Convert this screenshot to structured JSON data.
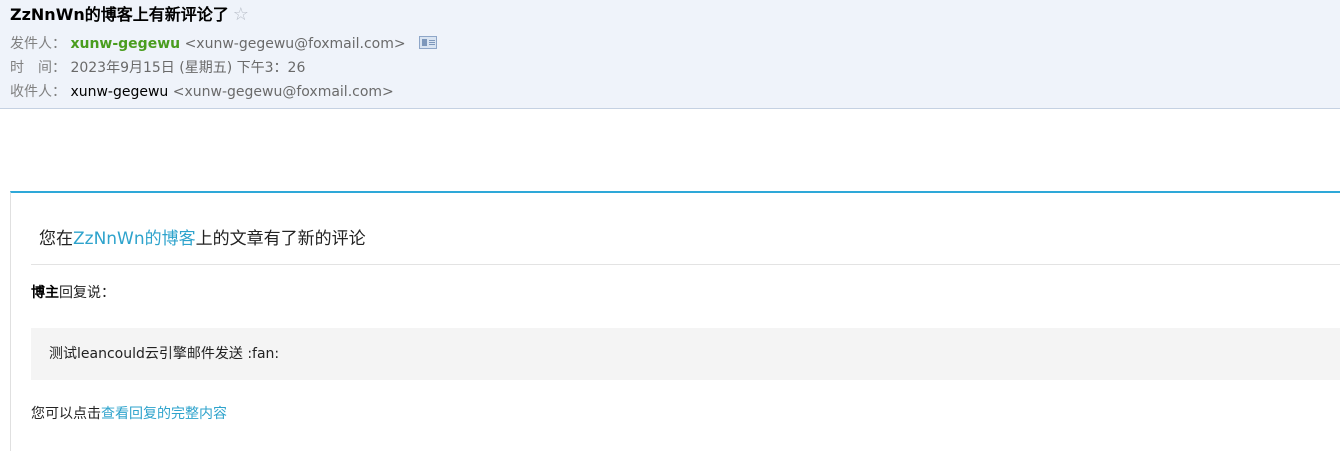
{
  "subject": "ZzNnWn的博客上有新评论了",
  "star_icon": "☆",
  "from": {
    "label": "发件人：",
    "name": "xunw-gegewu",
    "address": "<xunw-gegewu@foxmail.com>"
  },
  "time": {
    "label": "时　间：",
    "value": "2023年9月15日 (星期五) 下午3：26"
  },
  "to": {
    "label": "收件人：",
    "name": "xunw-gegewu",
    "address": "<xunw-gegewu@foxmail.com>"
  },
  "body": {
    "intro_prefix": "您在",
    "blog_link": "ZzNnWn的博客",
    "intro_suffix": "上的文章有了新的评论",
    "reply_author": "博主",
    "reply_suffix": "回复说：",
    "quote": "测试leancould云引擎邮件发送 :fan:",
    "footer_prefix": "您可以点击",
    "footer_link": "查看回复的完整内容"
  },
  "colors": {
    "header_bg": "#eff3fa",
    "accent": "#2ea8d8",
    "sender_green": "#4a9d1f",
    "link": "#2ea3cc"
  }
}
